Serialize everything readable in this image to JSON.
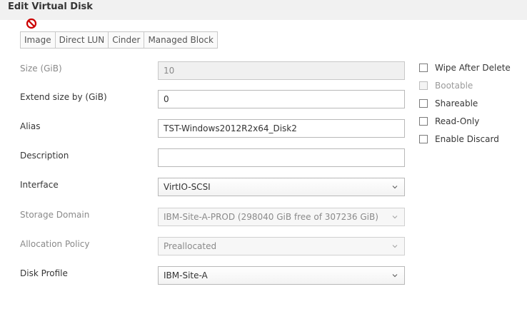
{
  "dialog": {
    "title": "Edit Virtual Disk"
  },
  "tabs": [
    "Image",
    "Direct LUN",
    "Cinder",
    "Managed Block"
  ],
  "form": {
    "size": {
      "label": "Size (GiB)",
      "value": "10"
    },
    "extend": {
      "label": "Extend size by (GiB)",
      "value": "0"
    },
    "alias": {
      "label": "Alias",
      "value": "TST-Windows2012R2x64_Disk2"
    },
    "description": {
      "label": "Description",
      "value": ""
    },
    "interface": {
      "label": "Interface",
      "value": "VirtIO-SCSI"
    },
    "storage_domain": {
      "label": "Storage Domain",
      "value": "IBM-Site-A-PROD (298040 GiB free of 307236 GiB)"
    },
    "allocation_policy": {
      "label": "Allocation Policy",
      "value": "Preallocated"
    },
    "disk_profile": {
      "label": "Disk Profile",
      "value": "IBM-Site-A"
    }
  },
  "options": {
    "wipe_after_delete": "Wipe After Delete",
    "bootable": "Bootable",
    "shareable": "Shareable",
    "read_only": "Read-Only",
    "enable_discard": "Enable Discard"
  },
  "icons": {
    "tab_blocked": "no-entry-icon",
    "dropdown": "chevron-down-icon"
  },
  "colors": {
    "blocked_icon": "#cc0000"
  }
}
